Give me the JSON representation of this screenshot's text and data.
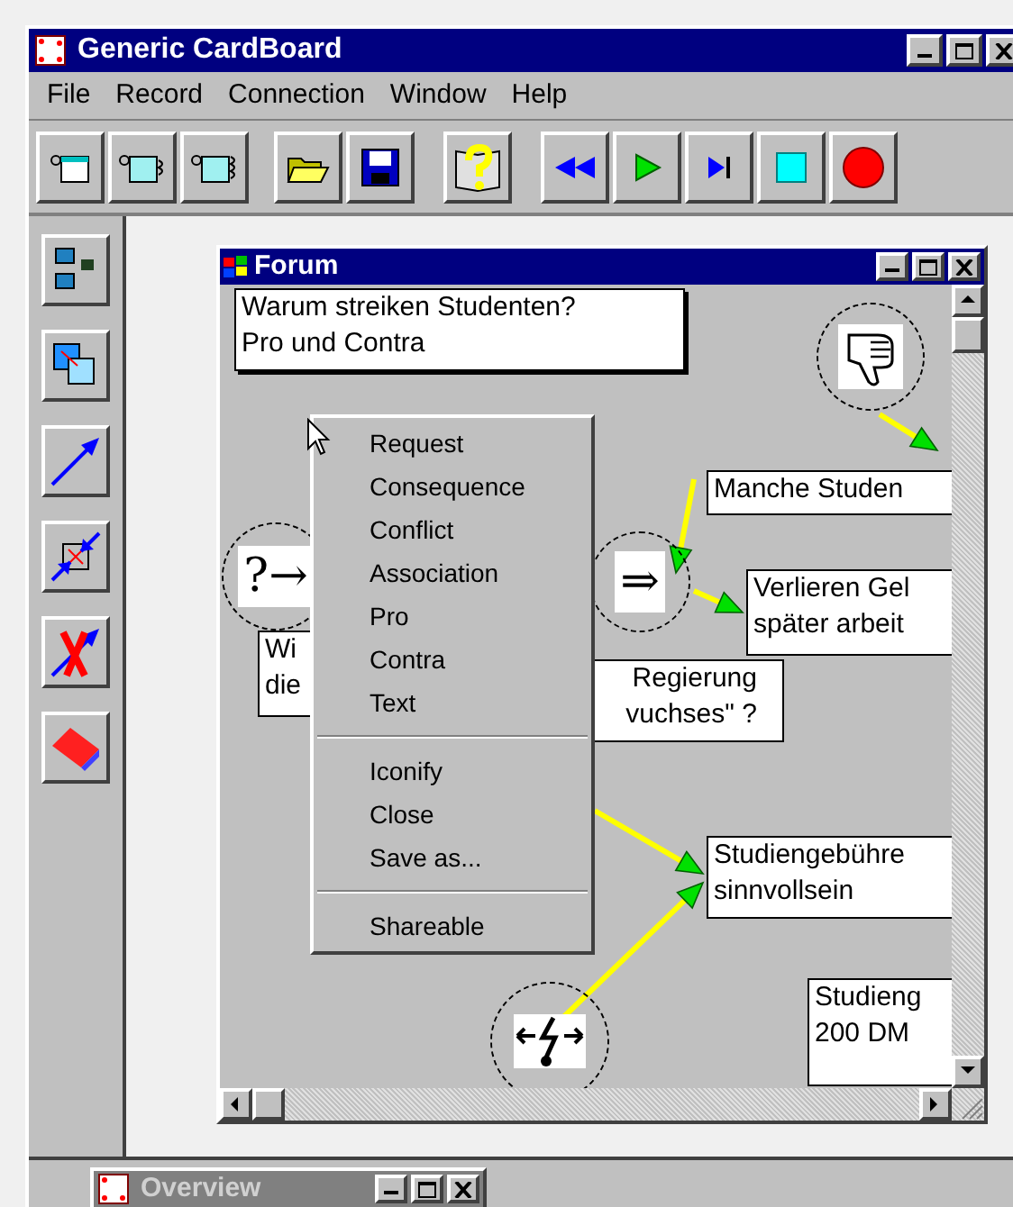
{
  "window": {
    "title": "Generic CardBoard"
  },
  "menu": [
    "File",
    "Record",
    "Connection",
    "Window",
    "Help"
  ],
  "forum": {
    "title": "Forum",
    "cards": [
      {
        "lines": [
          "Warum streiken Studenten?",
          "Pro und Contra"
        ]
      },
      {
        "lines": [
          "Manche Studen"
        ]
      },
      {
        "lines": [
          "Verlieren Gel",
          "später arbeit"
        ]
      },
      {
        "lines": [
          "Wi",
          "die"
        ]
      },
      {
        "lines": [
          "Regierung",
          "vuchses\" ?"
        ]
      },
      {
        "lines": [
          "Studiengebühre",
          "sinnvollsein"
        ]
      },
      {
        "lines": [
          "Studieng",
          "200 DM"
        ]
      }
    ],
    "nodes": [
      {
        "kind": "contra"
      },
      {
        "kind": "request",
        "symbol": "?→"
      },
      {
        "kind": "consequence",
        "symbol": "⇒"
      },
      {
        "kind": "conflict"
      }
    ],
    "context_menu": [
      [
        "Request",
        "Consequence",
        "Conflict",
        "Association",
        "Pro",
        "Contra",
        "Text"
      ],
      [
        "Iconify",
        "Close",
        "Save as..."
      ],
      [
        "Shareable"
      ]
    ]
  },
  "overview": {
    "title": "Overview"
  }
}
